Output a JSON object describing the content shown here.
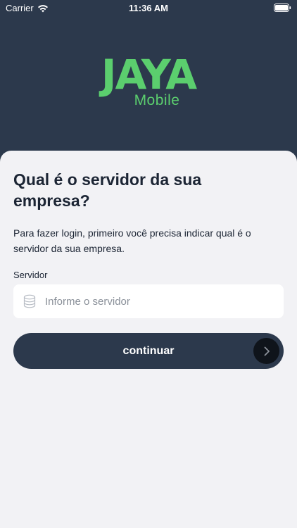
{
  "status_bar": {
    "carrier": "Carrier",
    "time": "11:36 AM",
    "wifi_icon": "wifi-icon",
    "battery_icon": "battery-icon"
  },
  "logo": {
    "main": "JAYA",
    "sub": "Mobile",
    "color": "#5bce6e"
  },
  "card": {
    "title": "Qual é o servidor da sua empresa?",
    "description": "Para fazer login, primeiro você precisa indicar qual é o servidor da sua empresa.",
    "field_label": "Servidor",
    "input": {
      "value": "",
      "placeholder": "Informe o servidor",
      "icon": "database-icon"
    },
    "continue_label": "continuar",
    "continue_icon": "chevron-right-icon"
  },
  "colors": {
    "header_bg": "#2c394c",
    "card_bg": "#f2f2f5",
    "text": "#1c2534",
    "accent": "#5bce6e"
  }
}
